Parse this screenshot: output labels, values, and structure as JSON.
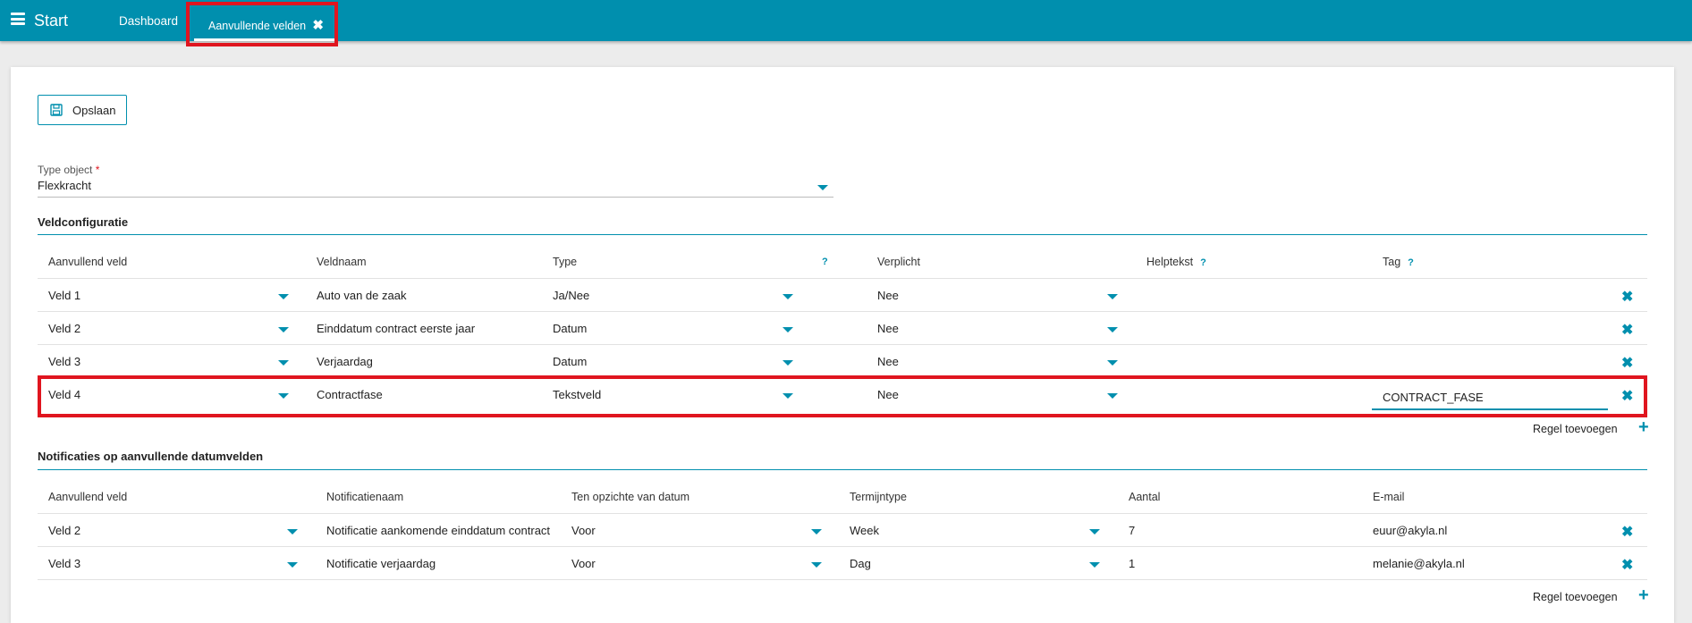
{
  "topbar": {
    "brand": "Start",
    "tabs": [
      {
        "label": "Dashboard"
      },
      {
        "label": "Aanvullende velden",
        "active": true
      }
    ]
  },
  "toolbar": {
    "save_label": "Opslaan"
  },
  "type_object": {
    "label": "Type object",
    "required_mark": "*",
    "value": "Flexkracht"
  },
  "veldconfiguratie": {
    "title": "Veldconfiguratie",
    "headers": {
      "aanvullend_veld": "Aanvullend veld",
      "veldnaam": "Veldnaam",
      "type": "Type",
      "type_help": "?",
      "verplicht": "Verplicht",
      "helptekst": "Helptekst",
      "helptekst_help": "?",
      "tag": "Tag",
      "tag_help": "?"
    },
    "rows": [
      {
        "veld": "Veld 1",
        "veldnaam": "Auto van de zaak",
        "type": "Ja/Nee",
        "verplicht": "Nee",
        "helptekst": "",
        "tag": ""
      },
      {
        "veld": "Veld 2",
        "veldnaam": "Einddatum contract eerste jaar",
        "type": "Datum",
        "verplicht": "Nee",
        "helptekst": "",
        "tag": ""
      },
      {
        "veld": "Veld 3",
        "veldnaam": "Verjaardag",
        "type": "Datum",
        "verplicht": "Nee",
        "helptekst": "",
        "tag": ""
      },
      {
        "veld": "Veld 4",
        "veldnaam": "Contractfase",
        "type": "Tekstveld",
        "verplicht": "Nee",
        "helptekst": "",
        "tag": "CONTRACT_FASE"
      }
    ],
    "add_row_label": "Regel toevoegen"
  },
  "notificaties": {
    "title": "Notificaties op aanvullende datumvelden",
    "headers": {
      "aanvullend_veld": "Aanvullend veld",
      "notificatienaam": "Notificatienaam",
      "ten_opzichte": "Ten opzichte van datum",
      "termijntype": "Termijntype",
      "aantal": "Aantal",
      "email": "E-mail"
    },
    "rows": [
      {
        "veld": "Veld 2",
        "naam": "Notificatie aankomende einddatum contract",
        "ten_opzichte": "Voor",
        "termijntype": "Week",
        "aantal": "7",
        "email": "euur@akyla.nl"
      },
      {
        "veld": "Veld 3",
        "naam": "Notificatie verjaardag",
        "ten_opzichte": "Voor",
        "termijntype": "Dag",
        "aantal": "1",
        "email": "melanie@akyla.nl"
      }
    ],
    "add_row_label": "Regel toevoegen"
  },
  "icons": {
    "menu": "hamburger-icon",
    "close": "close-icon",
    "save": "floppy-disk-icon",
    "dropdown": "caret-down-icon",
    "delete": "close-icon",
    "add": "plus-icon"
  },
  "colors": {
    "primary": "#008fae",
    "highlight": "#e0151f",
    "required": "#e0151f"
  }
}
